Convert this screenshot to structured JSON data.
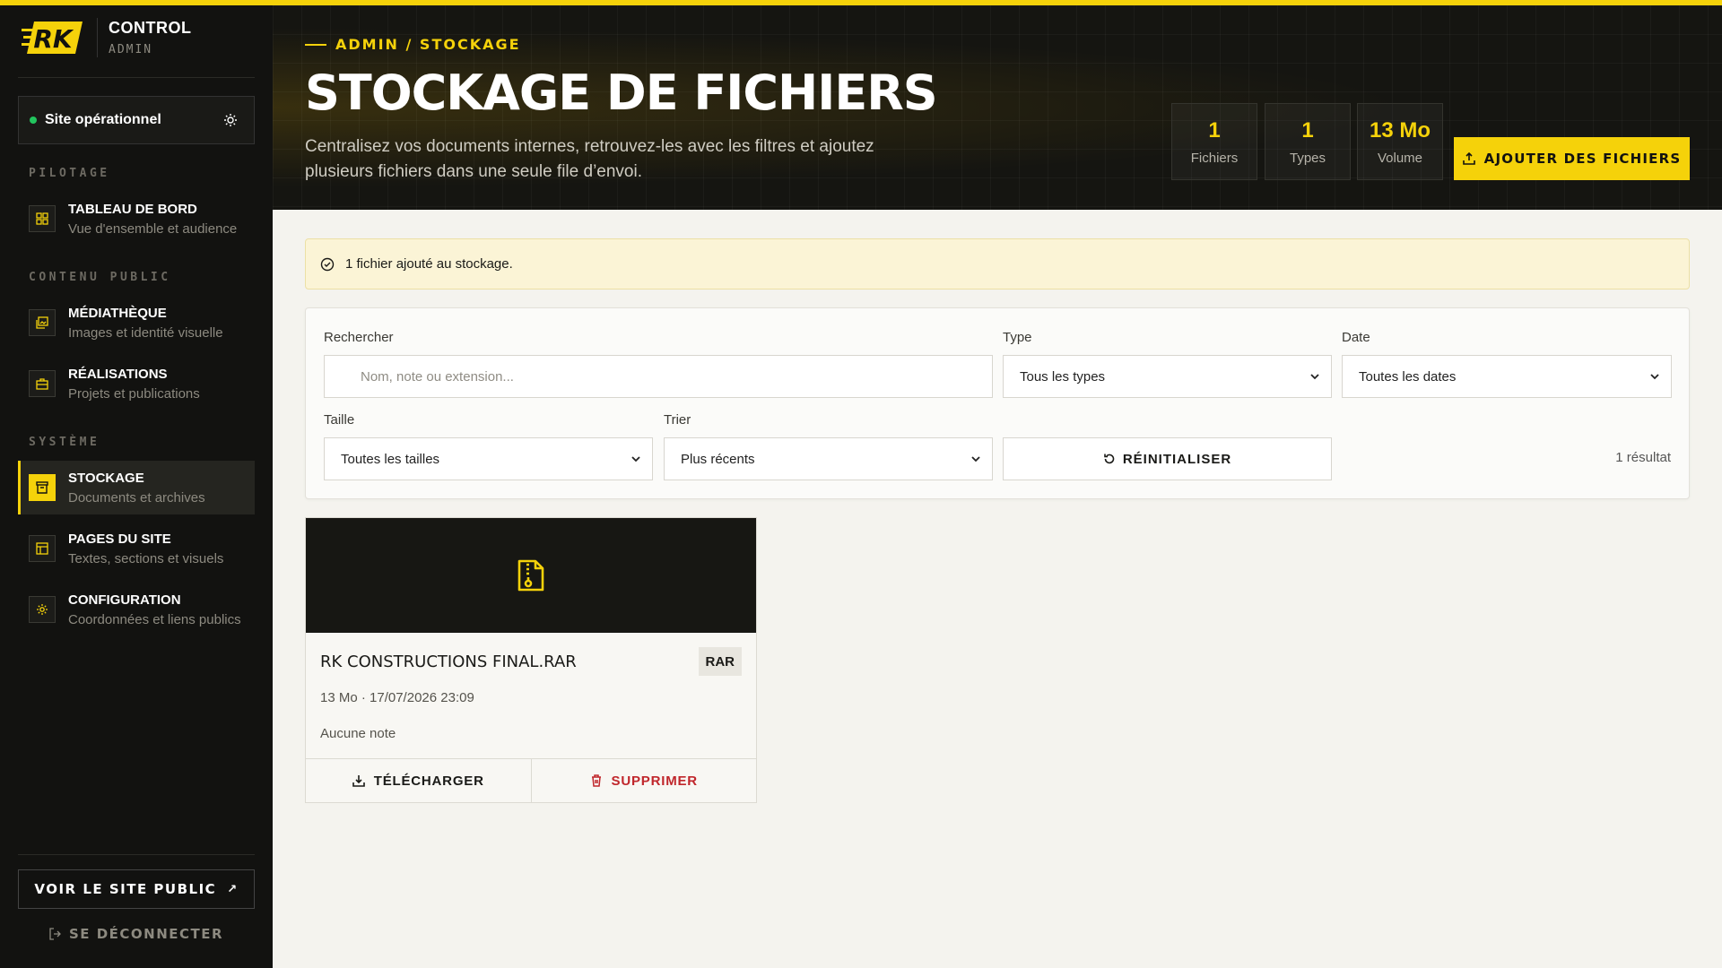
{
  "brand": {
    "logo_text": "RK",
    "title": "CONTROL",
    "subtitle": "ADMIN"
  },
  "status": {
    "label": "Site opérationnel",
    "dot_color": "#22c55e"
  },
  "sidebar": {
    "sections": [
      {
        "label": "PILOTAGE"
      },
      {
        "label": "CONTENU PUBLIC"
      },
      {
        "label": "SYSTÈME"
      }
    ],
    "items": [
      {
        "title": "TABLEAU DE BORD",
        "subtitle": "Vue d'ensemble et audience",
        "icon": "grid-icon"
      },
      {
        "title": "MÉDIATHÈQUE",
        "subtitle": "Images et identité visuelle",
        "icon": "images-icon"
      },
      {
        "title": "RÉALISATIONS",
        "subtitle": "Projets et publications",
        "icon": "briefcase-icon"
      },
      {
        "title": "STOCKAGE",
        "subtitle": "Documents et archives",
        "icon": "archive-icon",
        "active": true
      },
      {
        "title": "PAGES DU SITE",
        "subtitle": "Textes, sections et visuels",
        "icon": "layout-icon"
      },
      {
        "title": "CONFIGURATION",
        "subtitle": "Coordonnées et liens publics",
        "icon": "settings-icon"
      }
    ],
    "public_site_label": "VOIR LE SITE PUBLIC",
    "logout_label": "SE DÉCONNECTER"
  },
  "header": {
    "breadcrumb": "ADMIN / STOCKAGE",
    "title": "STOCKAGE DE FICHIERS",
    "description": "Centralisez vos documents internes, retrouvez-les avec les filtres et ajoutez plusieurs fichiers dans une seule file d’envoi.",
    "stats": [
      {
        "value": "1",
        "label": "Fichiers"
      },
      {
        "value": "1",
        "label": "Types"
      },
      {
        "value": "13 Mo",
        "label": "Volume"
      }
    ],
    "add_button": "AJOUTER DES FICHIERS"
  },
  "notice": {
    "text": "1 fichier ajouté au stockage."
  },
  "filters": {
    "search_label": "Rechercher",
    "search_placeholder": "Nom, note ou extension...",
    "type_label": "Type",
    "type_value": "Tous les types",
    "date_label": "Date",
    "date_value": "Toutes les dates",
    "size_label": "Taille",
    "size_value": "Toutes les tailles",
    "sort_label": "Trier",
    "sort_value": "Plus récents",
    "reset_label": "RÉINITIALISER",
    "result_count": "1 résultat"
  },
  "files": [
    {
      "name": "RK CONSTRUCTIONS FINAL.RAR",
      "ext": "RAR",
      "meta": "13 Mo · 17/07/2026 23:09",
      "note": "Aucune note",
      "download_label": "TÉLÉCHARGER",
      "delete_label": "SUPPRIMER",
      "icon": "file-archive-icon"
    }
  ],
  "colors": {
    "accent": "#f5d20a",
    "sidebar_bg": "#121210",
    "danger": "#c0262b"
  }
}
